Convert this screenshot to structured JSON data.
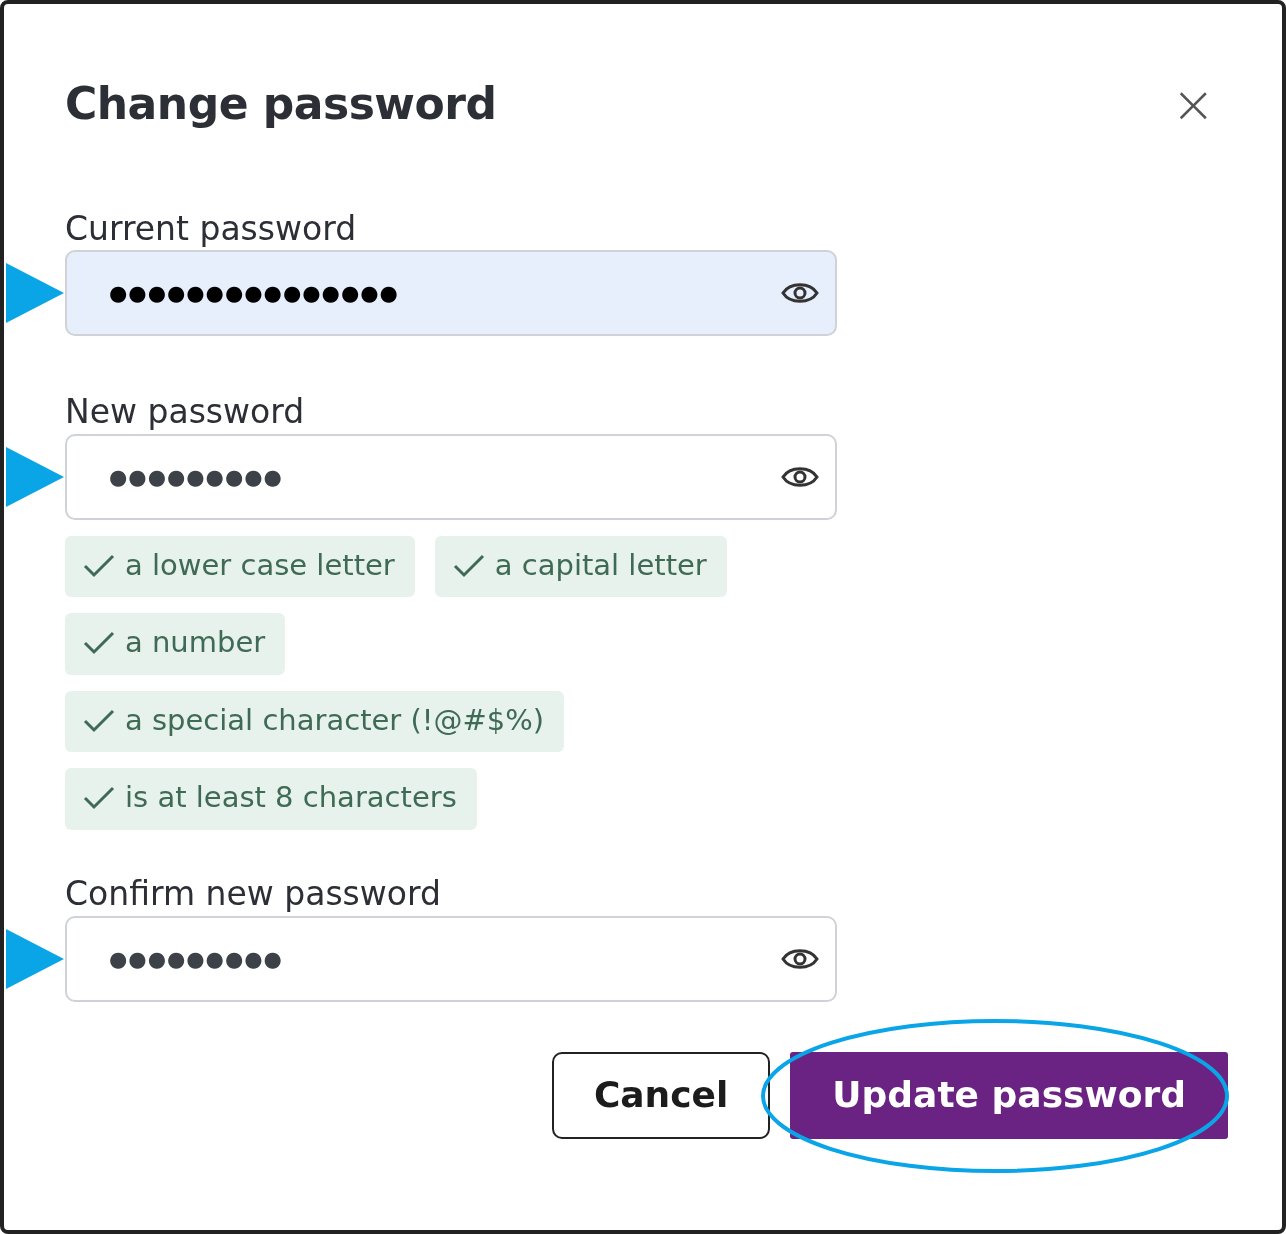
{
  "dialog": {
    "title": "Change password",
    "close_label": "×"
  },
  "fields": [
    {
      "label": "Current password",
      "value": "●●●●●●●●●●●●●●●",
      "autofilled": true,
      "pointed": true
    },
    {
      "label": "New password",
      "value": "●●●●●●●●●",
      "autofilled": false,
      "pointed": true,
      "requirements": [
        {
          "text": "a lower case letter",
          "met": true
        },
        {
          "text": "a capital letter",
          "met": true
        },
        {
          "text": "a number",
          "met": true
        },
        {
          "text": "a special character (!@#$%)",
          "met": true
        },
        {
          "text": "is at least 8 characters",
          "met": true
        }
      ]
    },
    {
      "label": "Confirm new password",
      "value": "●●●●●●●●●",
      "autofilled": false,
      "pointed": true
    }
  ],
  "buttons": [
    {
      "label": "Cancel",
      "kind": "secondary",
      "highlighted": false
    },
    {
      "label": "Update password",
      "kind": "primary",
      "highlighted": true
    }
  ]
}
